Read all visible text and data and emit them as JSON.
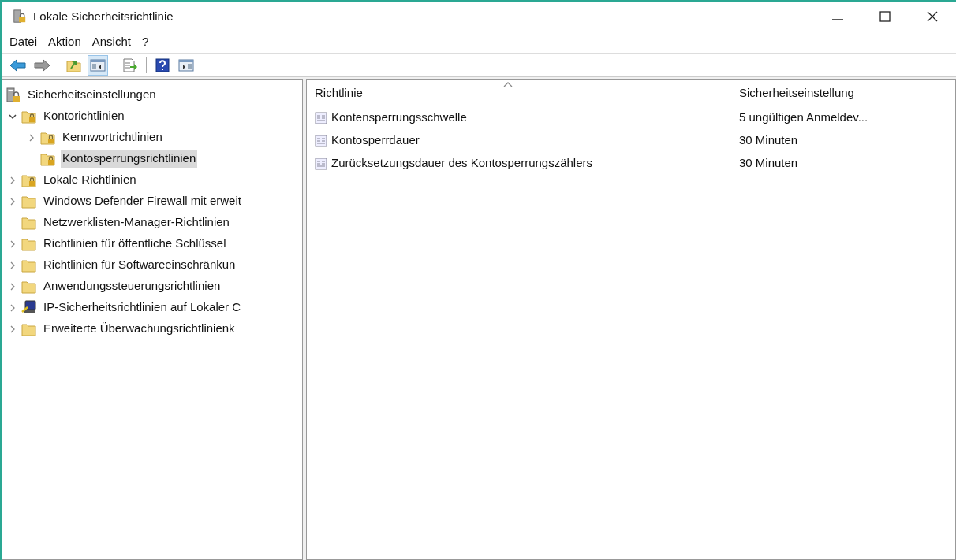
{
  "window": {
    "title": "Lokale Sicherheitsrichtlinie"
  },
  "menu": [
    "Datei",
    "Aktion",
    "Ansicht",
    "?"
  ],
  "toolbar": [
    {
      "kind": "back",
      "pressed": false
    },
    {
      "kind": "forward",
      "pressed": false
    },
    {
      "kind": "sep"
    },
    {
      "kind": "up",
      "pressed": false
    },
    {
      "kind": "tree",
      "pressed": true
    },
    {
      "kind": "sep"
    },
    {
      "kind": "export",
      "pressed": false
    },
    {
      "kind": "sep"
    },
    {
      "kind": "help",
      "pressed": false
    },
    {
      "kind": "pane",
      "pressed": false
    }
  ],
  "tree": [
    {
      "label": "Sicherheitseinstellungen",
      "kind": "shield",
      "selected": false,
      "children": [
        {
          "label": "Kontorichtlinien",
          "kind": "lockfolder",
          "expanded": true,
          "selected": false,
          "children": [
            {
              "label": "Kennwortrichtlinien",
              "kind": "lockfolder",
              "expanded": false,
              "selected": false
            },
            {
              "label": "Kontosperrungsrichtlinien",
              "kind": "lockfolder",
              "selected": true
            }
          ]
        },
        {
          "label": "Lokale Richtlinien",
          "kind": "lockfolder",
          "expanded": false,
          "selected": false
        },
        {
          "label": "Windows Defender Firewall mit erweit",
          "kind": "folder",
          "expanded": false,
          "selected": false
        },
        {
          "label": "Netzwerklisten-Manager-Richtlinien",
          "kind": "folder",
          "selected": false
        },
        {
          "label": "Richtlinien für öffentliche Schlüssel",
          "kind": "folder",
          "expanded": false,
          "selected": false
        },
        {
          "label": "Richtlinien für Softwareeinschränkun",
          "kind": "folder",
          "expanded": false,
          "selected": false
        },
        {
          "label": "Anwendungssteuerungsrichtlinien",
          "kind": "folder",
          "expanded": false,
          "selected": false
        },
        {
          "label": "IP-Sicherheitsrichtlinien auf Lokaler C",
          "kind": "network",
          "expanded": false,
          "selected": false
        },
        {
          "label": "Erweiterte Überwachungsrichtlinienk",
          "kind": "folder",
          "expanded": false,
          "selected": false
        }
      ]
    }
  ],
  "table": {
    "columns": [
      {
        "label": "Richtlinie",
        "sorted": true
      },
      {
        "label": "Sicherheitseinstellung",
        "sorted": false
      }
    ],
    "rows": [
      [
        "Kontensperrungsschwelle",
        "5 ungültigen Anmeldev..."
      ],
      [
        "Kontosperrdauer",
        "30 Minuten"
      ],
      [
        "Zurücksetzungsdauer des Kontosperrungszählers",
        "30 Minuten"
      ]
    ]
  }
}
